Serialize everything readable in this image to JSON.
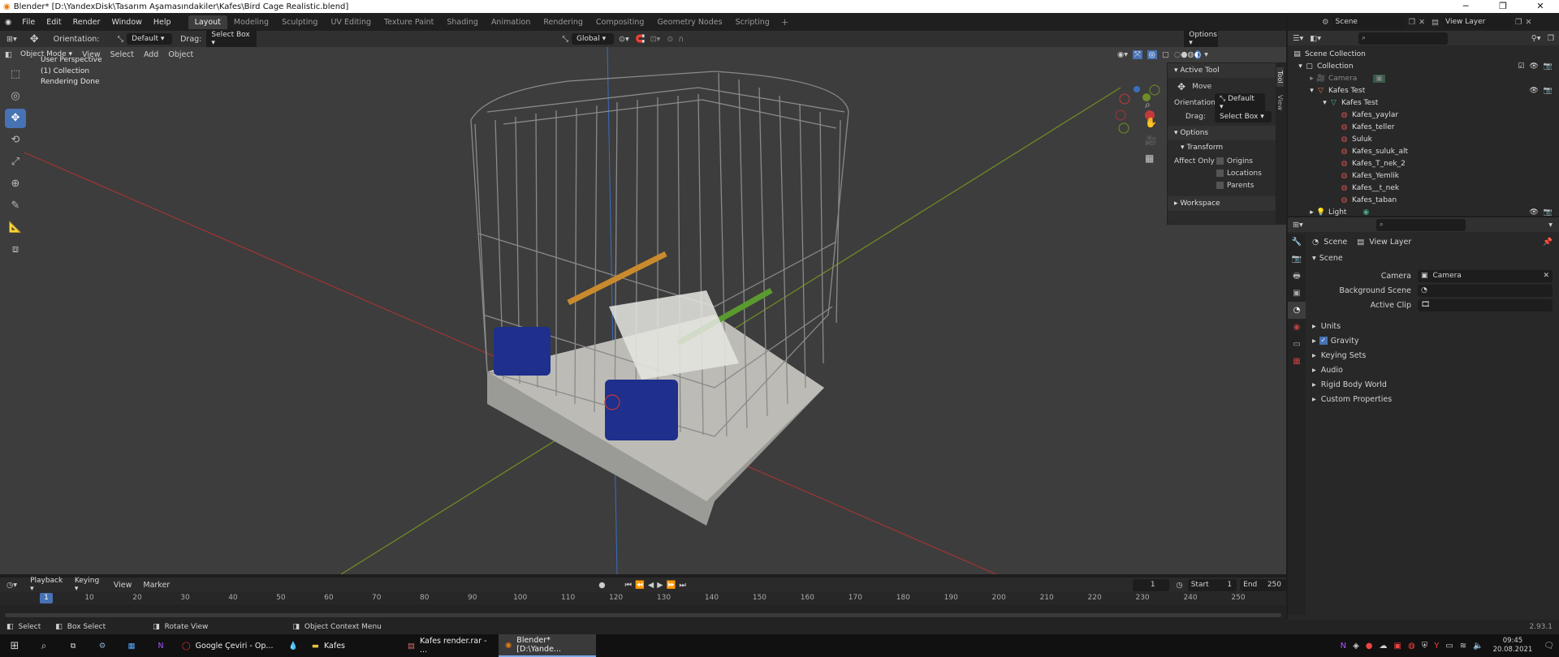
{
  "window": {
    "title": "Blender* [D:\\YandexDisk\\Tasarım Aşamasındakiler\\Kafes\\Bird Cage Realistic.blend]"
  },
  "menu": {
    "items": [
      "File",
      "Edit",
      "Render",
      "Window",
      "Help"
    ]
  },
  "workspaces": [
    "Layout",
    "Modeling",
    "Sculpting",
    "UV Editing",
    "Texture Paint",
    "Shading",
    "Animation",
    "Rendering",
    "Compositing",
    "Geometry Nodes",
    "Scripting"
  ],
  "topright": {
    "scene": "Scene",
    "view_layer": "View Layer"
  },
  "toolheader": {
    "orientation_label": "Orientation:",
    "orientation": "Default",
    "drag_label": "Drag:",
    "drag": "Select Box",
    "transform": "Global",
    "options": "Options"
  },
  "viewheader": {
    "mode": "Object Mode",
    "items": [
      "View",
      "Select",
      "Add",
      "Object"
    ]
  },
  "overlay": {
    "line1": "User Perspective",
    "line2": "(1) Collection",
    "line3": "Rendering Done"
  },
  "npanel": {
    "active_tool": "Active Tool",
    "tool": "Move",
    "orientation_label": "Orientation",
    "orientation": "Default",
    "drag_label": "Drag:",
    "drag": "Select Box",
    "options": "Options",
    "transform": "Transform",
    "affect_only": "Affect Only",
    "checks": [
      "Origins",
      "Locations",
      "Parents"
    ],
    "workspace": "Workspace",
    "tabs": [
      "Tool",
      "View"
    ]
  },
  "outliner": {
    "root": "Scene Collection",
    "collection": "Collection",
    "camera": "Camera",
    "kafes_test": "Kafes Test",
    "kafes_test_mesh": "Kafes Test",
    "materials": [
      "Kafes_yaylar",
      "Kafes_teller",
      "Suluk",
      "Kafes_suluk_alt",
      "Kafes_T_nek_2",
      "Kafes_Yemlik",
      "Kafes__t_nek",
      "Kafes_taban"
    ],
    "light": "Light"
  },
  "properties": {
    "crumb_scene": "Scene",
    "crumb_layer": "View Layer",
    "section": "Scene",
    "camera_label": "Camera",
    "camera": "Camera",
    "bg_label": "Background Scene",
    "clip_label": "Active Clip",
    "subsections": [
      "Units",
      "Gravity",
      "Keying Sets",
      "Audio",
      "Rigid Body World",
      "Custom Properties"
    ]
  },
  "timeline": {
    "menus": [
      "Playback",
      "Keying",
      "View",
      "Marker"
    ],
    "current": "1",
    "start_label": "Start",
    "start": "1",
    "end_label": "End",
    "end": "250",
    "ticks": [
      "1",
      "10",
      "20",
      "30",
      "40",
      "50",
      "60",
      "70",
      "80",
      "90",
      "100",
      "110",
      "120",
      "130",
      "140",
      "150",
      "160",
      "170",
      "180",
      "190",
      "200",
      "210",
      "220",
      "230",
      "240",
      "250"
    ]
  },
  "status": {
    "select": "Select",
    "box_select": "Box Select",
    "rotate": "Rotate View",
    "context": "Object Context Menu",
    "version": "2.93.1"
  },
  "taskbar": {
    "apps": [
      "Google Çeviri - Op...",
      "Kafes",
      "Kafes render.rar - ...",
      "Blender* [D:\\Yande..."
    ],
    "time": "09:45",
    "date": "20.08.2021"
  },
  "colors": {
    "accent": "#4772b3",
    "viewport": "#3d3d3d",
    "x_axis": "#b03a3a",
    "y_axis": "#7a9a2a",
    "z_axis": "#3a6ec0"
  }
}
